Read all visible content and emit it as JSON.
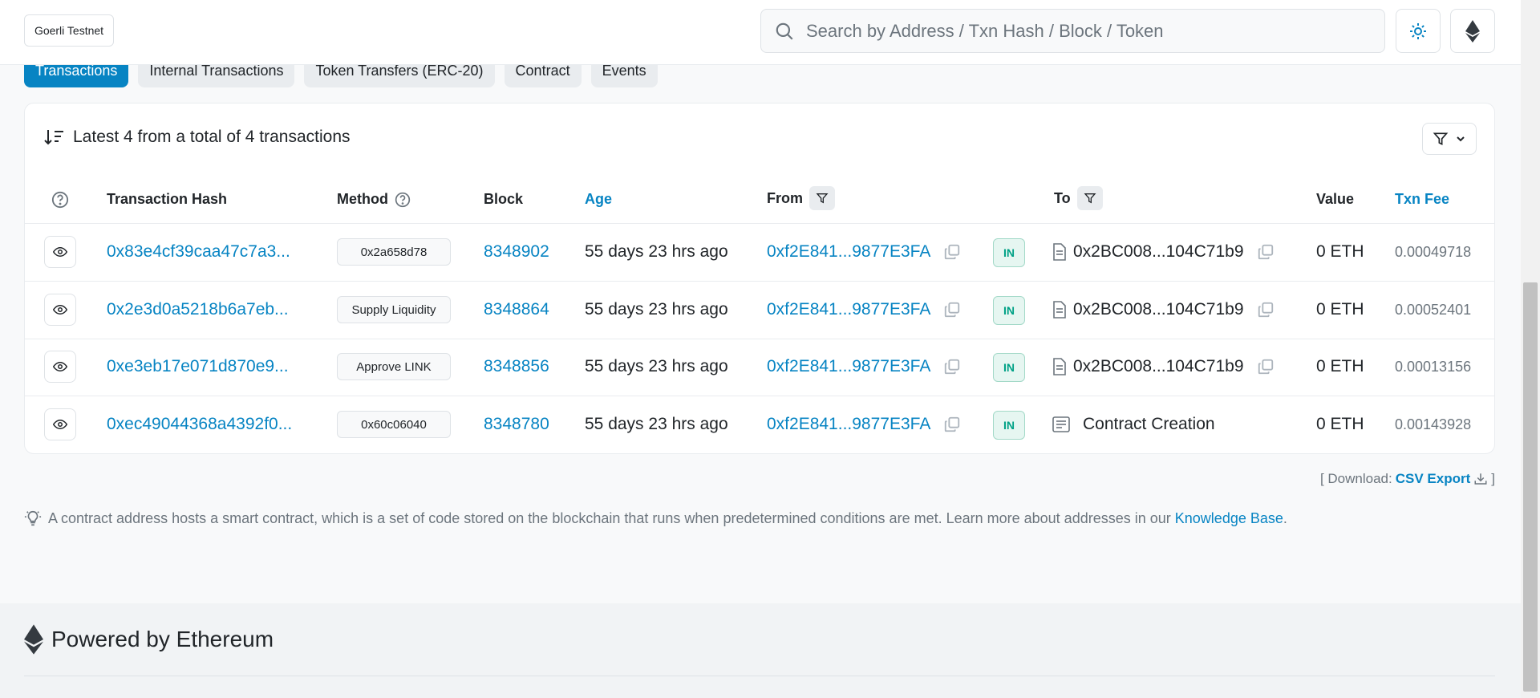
{
  "header": {
    "network_label": "Goerli Testnet",
    "search_placeholder": "Search by Address / Txn Hash / Block / Token"
  },
  "tabs": [
    {
      "label": "Transactions",
      "active": true
    },
    {
      "label": "Internal Transactions"
    },
    {
      "label": "Token Transfers (ERC-20)"
    },
    {
      "label": "Contract"
    },
    {
      "label": "Events"
    }
  ],
  "summary": "Latest 4 from a total of 4 transactions",
  "columns": {
    "hash": "Transaction Hash",
    "method": "Method",
    "block": "Block",
    "age": "Age",
    "from": "From",
    "to": "To",
    "value": "Value",
    "fee": "Txn Fee"
  },
  "rows": [
    {
      "hash": "0x83e4cf39caa47c7a3...",
      "method": "0x2a658d78",
      "block": "8348902",
      "age": "55 days 23 hrs ago",
      "from": "0xf2E841...9877E3FA",
      "direction": "IN",
      "to": "0x2BC008...104C71b9",
      "value": "0 ETH",
      "fee": "0.00049718"
    },
    {
      "hash": "0x2e3d0a5218b6a7eb...",
      "method": "Supply Liquidity",
      "block": "8348864",
      "age": "55 days 23 hrs ago",
      "from": "0xf2E841...9877E3FA",
      "direction": "IN",
      "to": "0x2BC008...104C71b9",
      "value": "0 ETH",
      "fee": "0.00052401"
    },
    {
      "hash": "0xe3eb17e071d870e9...",
      "method": "Approve LINK",
      "block": "8348856",
      "age": "55 days 23 hrs ago",
      "from": "0xf2E841...9877E3FA",
      "direction": "IN",
      "to": "0x2BC008...104C71b9",
      "value": "0 ETH",
      "fee": "0.00013156"
    },
    {
      "hash": "0xec49044368a4392f0...",
      "method": "0x60c06040",
      "block": "8348780",
      "age": "55 days 23 hrs ago",
      "from": "0xf2E841...9877E3FA",
      "direction": "IN",
      "to": "Contract Creation",
      "value": "0 ETH",
      "fee": "0.00143928"
    }
  ],
  "download": {
    "open": "[ Download:",
    "link": "CSV Export",
    "close": "]"
  },
  "note": {
    "text": "A contract address hosts a smart contract, which is a set of code stored on the blockchain that runs when predetermined conditions are met. Learn more about addresses in our",
    "link": "Knowledge Base",
    "end": "."
  },
  "footer": {
    "powered": "Powered by Ethereum"
  }
}
